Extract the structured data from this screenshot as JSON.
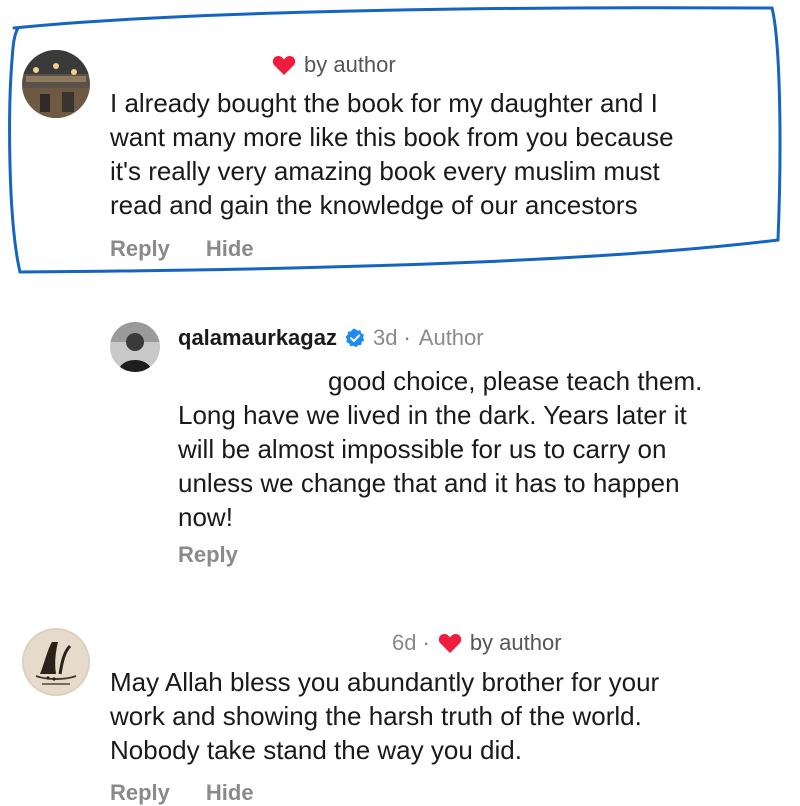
{
  "comments": [
    {
      "badge": "by author",
      "lines": [
        "I already bought the book for my daughter and I",
        "want many more like this book from you because",
        "it's really very amazing book every muslim must",
        "read and gain the knowledge of our ancestors"
      ],
      "actions": [
        "Reply",
        "Hide"
      ],
      "highlighted": true
    },
    {
      "username": "qalamaurkagaz",
      "time": "3d",
      "role": "Author",
      "lines": [
        "good choice, please teach them.",
        "Long have we lived in the dark. Years later it",
        "will be almost impossible for us to carry on",
        "unless we change that and it has to happen",
        "now!"
      ],
      "actions": [
        "Reply"
      ]
    },
    {
      "time": "6d",
      "badge": "by author",
      "lines": [
        "May Allah bless you abundantly brother for your",
        "work and showing the harsh truth of the world.",
        "Nobody take stand the way you did."
      ],
      "actions": [
        "Reply",
        "Hide"
      ]
    }
  ],
  "colors": {
    "heart": "#ee1d3e",
    "verified": "#1d8cf0",
    "highlight_ring": "#1565c0",
    "action_text": "#8a8a8a"
  }
}
